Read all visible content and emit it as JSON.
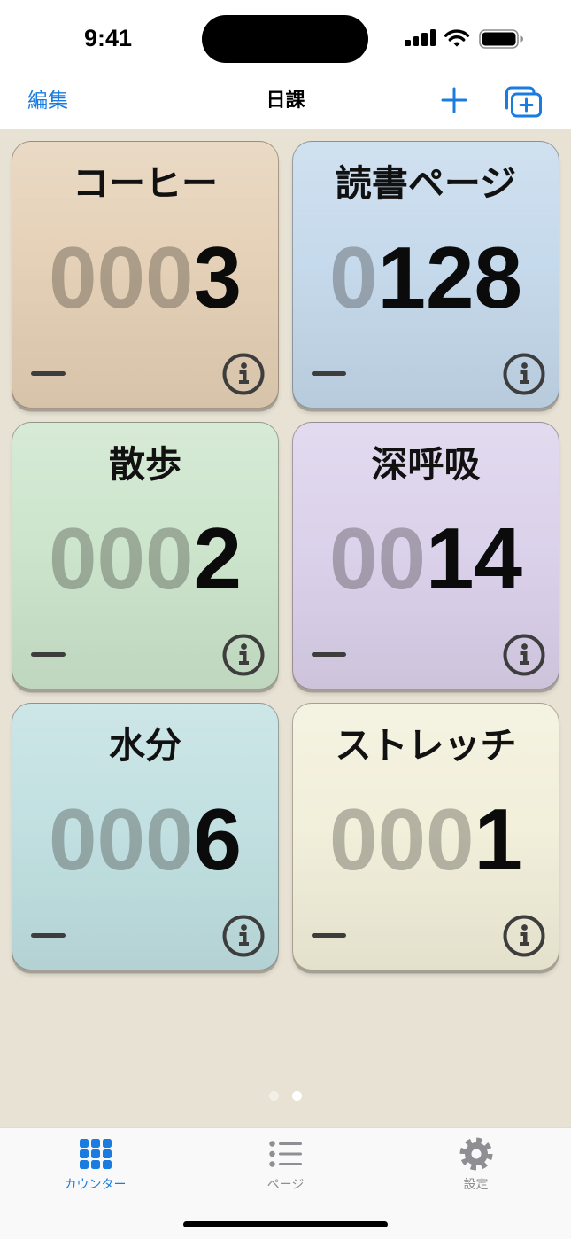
{
  "colors": {
    "accent": "#1a7be0",
    "background": "#e7e2d4",
    "inactive": "#8e8e93",
    "control": "#3d3d3d"
  },
  "status_bar": {
    "time": "9:41",
    "icons": [
      "signal-icon",
      "wifi-icon",
      "battery-icon"
    ]
  },
  "nav": {
    "edit_label": "編集",
    "title": "日課",
    "actions": [
      "plus-icon",
      "add-stack-icon"
    ]
  },
  "counters": [
    {
      "name": "コーヒー",
      "zeros": "000",
      "count": "3",
      "color": "#e4cfb4"
    },
    {
      "name": "読書ページ",
      "zeros": "0",
      "count": "128",
      "color": "#c3d8eb"
    },
    {
      "name": "散歩",
      "zeros": "000",
      "count": "2",
      "color": "#cbe4ca"
    },
    {
      "name": "深呼吸",
      "zeros": "00",
      "count": "14",
      "color": "#dad0ea"
    },
    {
      "name": "水分",
      "zeros": "000",
      "count": "6",
      "color": "#bfdfe0"
    },
    {
      "name": "ストレッチ",
      "zeros": "000",
      "count": "1",
      "color": "#f1efd9"
    }
  ],
  "counter_controls": {
    "decrement_icon": "minus-icon",
    "info_icon": "info-circle-icon"
  },
  "pager": {
    "pages": 2,
    "current": 2
  },
  "tab_bar": {
    "items": [
      {
        "label": "カウンター",
        "icon": "grid-icon",
        "selected": true
      },
      {
        "label": "ページ",
        "icon": "list-icon",
        "selected": false
      },
      {
        "label": "設定",
        "icon": "gear-icon",
        "selected": false
      }
    ]
  }
}
